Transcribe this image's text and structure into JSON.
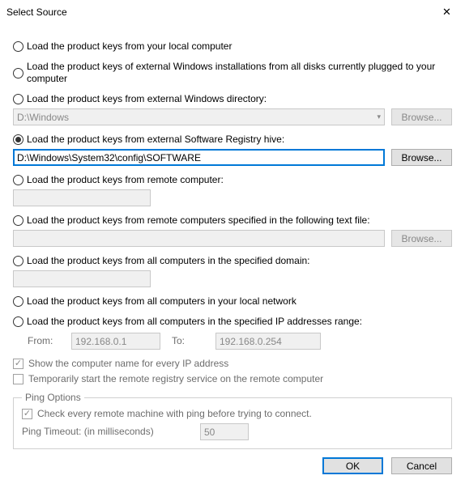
{
  "window": {
    "title": "Select Source",
    "close_glyph": "✕"
  },
  "options": {
    "local": "Load the product keys from your local computer",
    "external_all_disks": "Load the product keys of external Windows installations from all disks currently plugged to your computer",
    "external_windows_dir": "Load the product keys from external Windows directory:",
    "windows_dir_value": "D:\\Windows",
    "software_hive": "Load the product keys from external Software Registry hive:",
    "software_hive_value": "D:\\Windows\\System32\\config\\SOFTWARE",
    "remote_computer": "Load the product keys from remote computer:",
    "remote_computer_value": "",
    "remote_textfile": "Load the product keys from remote computers specified in the following text file:",
    "remote_textfile_value": "",
    "domain": "Load the product keys from all computers in the specified domain:",
    "domain_value": "",
    "local_network": "Load the product keys from all computers in your local network",
    "ip_range": "Load the product keys from all computers in the specified IP addresses range:",
    "ip_from_label": "From:",
    "ip_from_value": "192.168.0.1",
    "ip_to_label": "To:",
    "ip_to_value": "192.168.0.254"
  },
  "checks": {
    "show_computer_name": "Show the computer name for every IP address",
    "temp_remote_registry": "Temporarily start the remote registry service on the remote computer"
  },
  "ping": {
    "legend": "Ping Options",
    "check_label": "Check every remote machine with ping before trying to connect.",
    "timeout_label": "Ping Timeout: (in milliseconds)",
    "timeout_value": "50"
  },
  "buttons": {
    "browse": "Browse...",
    "ok": "OK",
    "cancel": "Cancel"
  }
}
